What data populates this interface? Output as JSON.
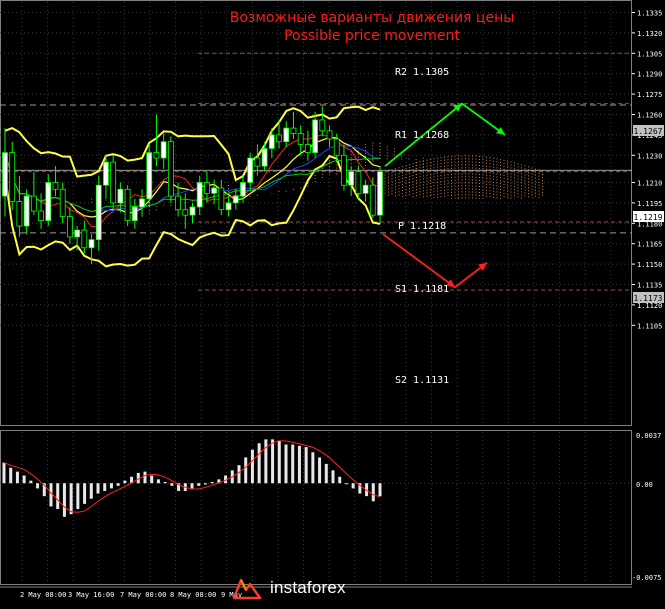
{
  "chart_data": {
    "type": "candlestick",
    "title": "Возможные варианты движения цены",
    "subtitle": "Possible price movement",
    "main_panel": {
      "ylim": [
        1.11,
        1.134
      ],
      "y_ticks": [
        "1.1335",
        "1.1320",
        "1.1305",
        "1.1290",
        "1.1275",
        "1.1260",
        "1.1245",
        "1.1230",
        "1.1210",
        "1.1195",
        "1.1180",
        "1.1165",
        "1.1150",
        "1.1135",
        "1.1120",
        "1.1105"
      ],
      "current_price_tag": "1.1219",
      "current_price": 1.1219,
      "levels": [
        {
          "name": "R2",
          "label": "R2 1.1305",
          "value": 1.1305
        },
        {
          "name": "R1",
          "label": "R1 1.1268",
          "value": 1.1268,
          "price_tag": "1.1267",
          "tag_value": 1.1267
        },
        {
          "name": "P",
          "label": "P 1.1218",
          "value": 1.1218
        },
        {
          "name": "S1",
          "label": "S1 1.1181",
          "value": 1.1181,
          "price_tag": "1.1173",
          "tag_value": 1.1173
        },
        {
          "name": "S2",
          "label": "S2 1.1131",
          "value": 1.1131
        }
      ],
      "arrows": [
        {
          "color": "#00ff00",
          "path": [
            [
              385,
              1.1222
            ],
            [
              462,
              1.1268
            ],
            [
              505,
              1.1245
            ]
          ]
        },
        {
          "color": "#ff2020",
          "path": [
            [
              383,
              1.1172
            ],
            [
              455,
              1.1133
            ],
            [
              487,
              1.1151
            ]
          ]
        }
      ],
      "candles": [
        [
          1.12,
          1.125,
          1.1185,
          1.1232
        ],
        [
          1.1232,
          1.124,
          1.119,
          1.1196
        ],
        [
          1.1196,
          1.1215,
          1.117,
          1.1178
        ],
        [
          1.1178,
          1.1205,
          1.1172,
          1.12
        ],
        [
          1.12,
          1.1218,
          1.1186,
          1.1189
        ],
        [
          1.1189,
          1.1202,
          1.1176,
          1.1182
        ],
        [
          1.1182,
          1.1216,
          1.1178,
          1.121
        ],
        [
          1.121,
          1.1222,
          1.12,
          1.1205
        ],
        [
          1.1205,
          1.121,
          1.118,
          1.1185
        ],
        [
          1.1185,
          1.1192,
          1.1165,
          1.117
        ],
        [
          1.117,
          1.1178,
          1.116,
          1.1175
        ],
        [
          1.1175,
          1.1182,
          1.1158,
          1.1162
        ],
        [
          1.1162,
          1.1172,
          1.115,
          1.1168
        ],
        [
          1.1168,
          1.1215,
          1.116,
          1.1208
        ],
        [
          1.1208,
          1.123,
          1.1198,
          1.1225
        ],
        [
          1.1225,
          1.123,
          1.119,
          1.1195
        ],
        [
          1.1195,
          1.121,
          1.1188,
          1.1205
        ],
        [
          1.1205,
          1.1208,
          1.1178,
          1.1182
        ],
        [
          1.1182,
          1.1198,
          1.1176,
          1.1192
        ],
        [
          1.1192,
          1.1205,
          1.1185,
          1.1198
        ],
        [
          1.1198,
          1.1238,
          1.1192,
          1.1232
        ],
        [
          1.1232,
          1.126,
          1.1222,
          1.1228
        ],
        [
          1.1228,
          1.1246,
          1.122,
          1.124
        ],
        [
          1.124,
          1.1244,
          1.1195,
          1.12
        ],
        [
          1.12,
          1.121,
          1.1185,
          1.119
        ],
        [
          1.119,
          1.1202,
          1.1176,
          1.1186
        ],
        [
          1.1186,
          1.1195,
          1.118,
          1.1192
        ],
        [
          1.1192,
          1.1215,
          1.1186,
          1.121
        ],
        [
          1.121,
          1.1218,
          1.1195,
          1.1202
        ],
        [
          1.1202,
          1.1212,
          1.1194,
          1.1206
        ],
        [
          1.1206,
          1.1212,
          1.1186,
          1.119
        ],
        [
          1.119,
          1.12,
          1.1185,
          1.1195
        ],
        [
          1.1195,
          1.1205,
          1.119,
          1.12
        ],
        [
          1.12,
          1.1215,
          1.1195,
          1.121
        ],
        [
          1.121,
          1.1232,
          1.1205,
          1.1228
        ],
        [
          1.1228,
          1.1238,
          1.1215,
          1.1222
        ],
        [
          1.1222,
          1.124,
          1.1218,
          1.1235
        ],
        [
          1.1235,
          1.125,
          1.1228,
          1.1245
        ],
        [
          1.1245,
          1.1256,
          1.1235,
          1.124
        ],
        [
          1.124,
          1.1255,
          1.1236,
          1.125
        ],
        [
          1.125,
          1.1262,
          1.1242,
          1.1246
        ],
        [
          1.1246,
          1.1252,
          1.123,
          1.1238
        ],
        [
          1.1238,
          1.1248,
          1.1226,
          1.1232
        ],
        [
          1.1232,
          1.1262,
          1.1228,
          1.1256
        ],
        [
          1.1256,
          1.1266,
          1.1244,
          1.1248
        ],
        [
          1.1248,
          1.1252,
          1.1236,
          1.1242
        ],
        [
          1.1242,
          1.1246,
          1.1225,
          1.123
        ],
        [
          1.123,
          1.1238,
          1.1204,
          1.1208
        ],
        [
          1.1208,
          1.1222,
          1.12,
          1.1218
        ],
        [
          1.1218,
          1.1222,
          1.1198,
          1.1202
        ],
        [
          1.1202,
          1.1212,
          1.1196,
          1.1208
        ],
        [
          1.1208,
          1.1214,
          1.1184,
          1.1186
        ],
        [
          1.1186,
          1.1222,
          1.118,
          1.1218
        ]
      ]
    },
    "oscillator_panel": {
      "ylim": [
        -0.0075,
        0.0037
      ],
      "y_ticks": [
        "0.0037",
        "0.00",
        "-0.0075"
      ],
      "histogram": [
        0.0016,
        0.0012,
        0.0009,
        0.0006,
        0.0002,
        -0.0004,
        -0.001,
        -0.0018,
        -0.002,
        -0.0026,
        -0.0024,
        -0.002,
        -0.0016,
        -0.0012,
        -0.0008,
        -0.0006,
        -0.0004,
        -0.0002,
        0.0002,
        0.0005,
        0.0008,
        0.0009,
        0.0006,
        0.0003,
        0.0001,
        -0.0002,
        -0.0006,
        -0.0006,
        -0.0004,
        -0.0002,
        -0.0001,
        0.0001,
        0.0003,
        0.0006,
        0.001,
        0.0014,
        0.002,
        0.0026,
        0.0031,
        0.0034,
        0.0034,
        0.0033,
        0.003,
        0.003,
        0.0029,
        0.0028,
        0.0024,
        0.002,
        0.0015,
        0.001,
        0.0005,
        0.0,
        -0.0004,
        -0.0008,
        -0.001,
        -0.0014,
        -0.001
      ]
    },
    "x_ticks": [
      "2 May 08:00",
      "3 May 16:00",
      "7 May 00:00",
      "8 May 08:00",
      "9 May"
    ],
    "brand": "instaforex"
  }
}
